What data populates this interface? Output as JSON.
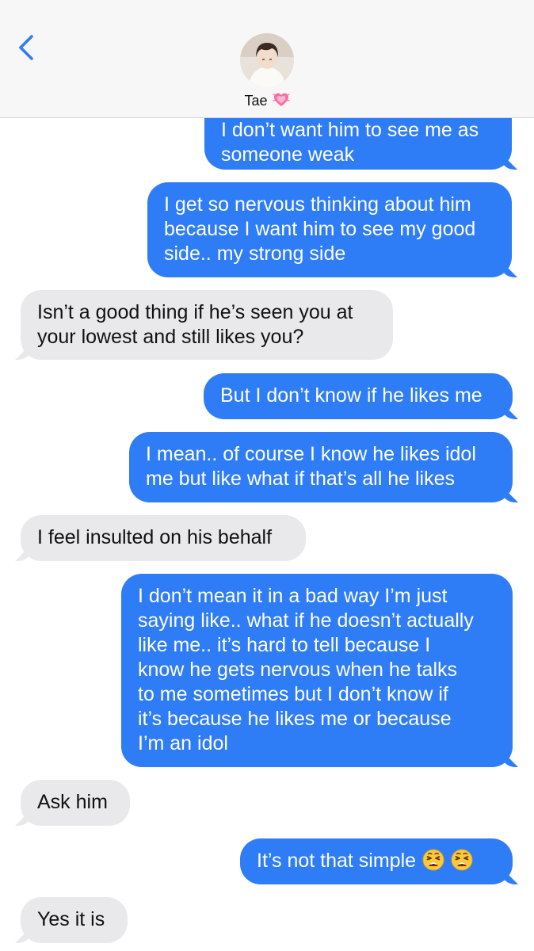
{
  "header": {
    "contact_name": "Tae",
    "heart_emoji": "💓",
    "back_icon": "chevron-left-icon",
    "accent_color": "#2e7cf6"
  },
  "messages": [
    {
      "direction": "outgoing",
      "lines": [
        "I don’t want him to see me as",
        "someone weak"
      ]
    },
    {
      "direction": "outgoing",
      "lines": [
        "I get so nervous thinking about him",
        "because I want him to see my good",
        "side.. my strong side"
      ]
    },
    {
      "direction": "incoming",
      "lines": [
        "Isn’t a good thing if he’s seen you at",
        "your lowest and still likes you?"
      ]
    },
    {
      "direction": "outgoing",
      "lines": [
        "But I don’t know if he likes me"
      ]
    },
    {
      "direction": "outgoing",
      "lines": [
        "I mean.. of course I know he likes idol",
        "me but like what if that’s all he likes"
      ]
    },
    {
      "direction": "incoming",
      "lines": [
        "I feel insulted on his behalf"
      ]
    },
    {
      "direction": "outgoing",
      "lines": [
        "I don’t mean it in a bad way I’m just",
        "saying like.. what if he doesn’t actually",
        "like me.. it’s hard to tell because I",
        "know he gets nervous when he talks",
        "to me sometimes but I don’t know if",
        "it’s because he likes me or because",
        "I’m an idol"
      ]
    },
    {
      "direction": "incoming",
      "lines": [
        "Ask him"
      ]
    },
    {
      "direction": "outgoing",
      "lines": [
        "It’s not that simple"
      ],
      "emojis": [
        "weary-face",
        "weary-face"
      ]
    },
    {
      "direction": "incoming",
      "lines": [
        "Yes it is"
      ]
    }
  ]
}
